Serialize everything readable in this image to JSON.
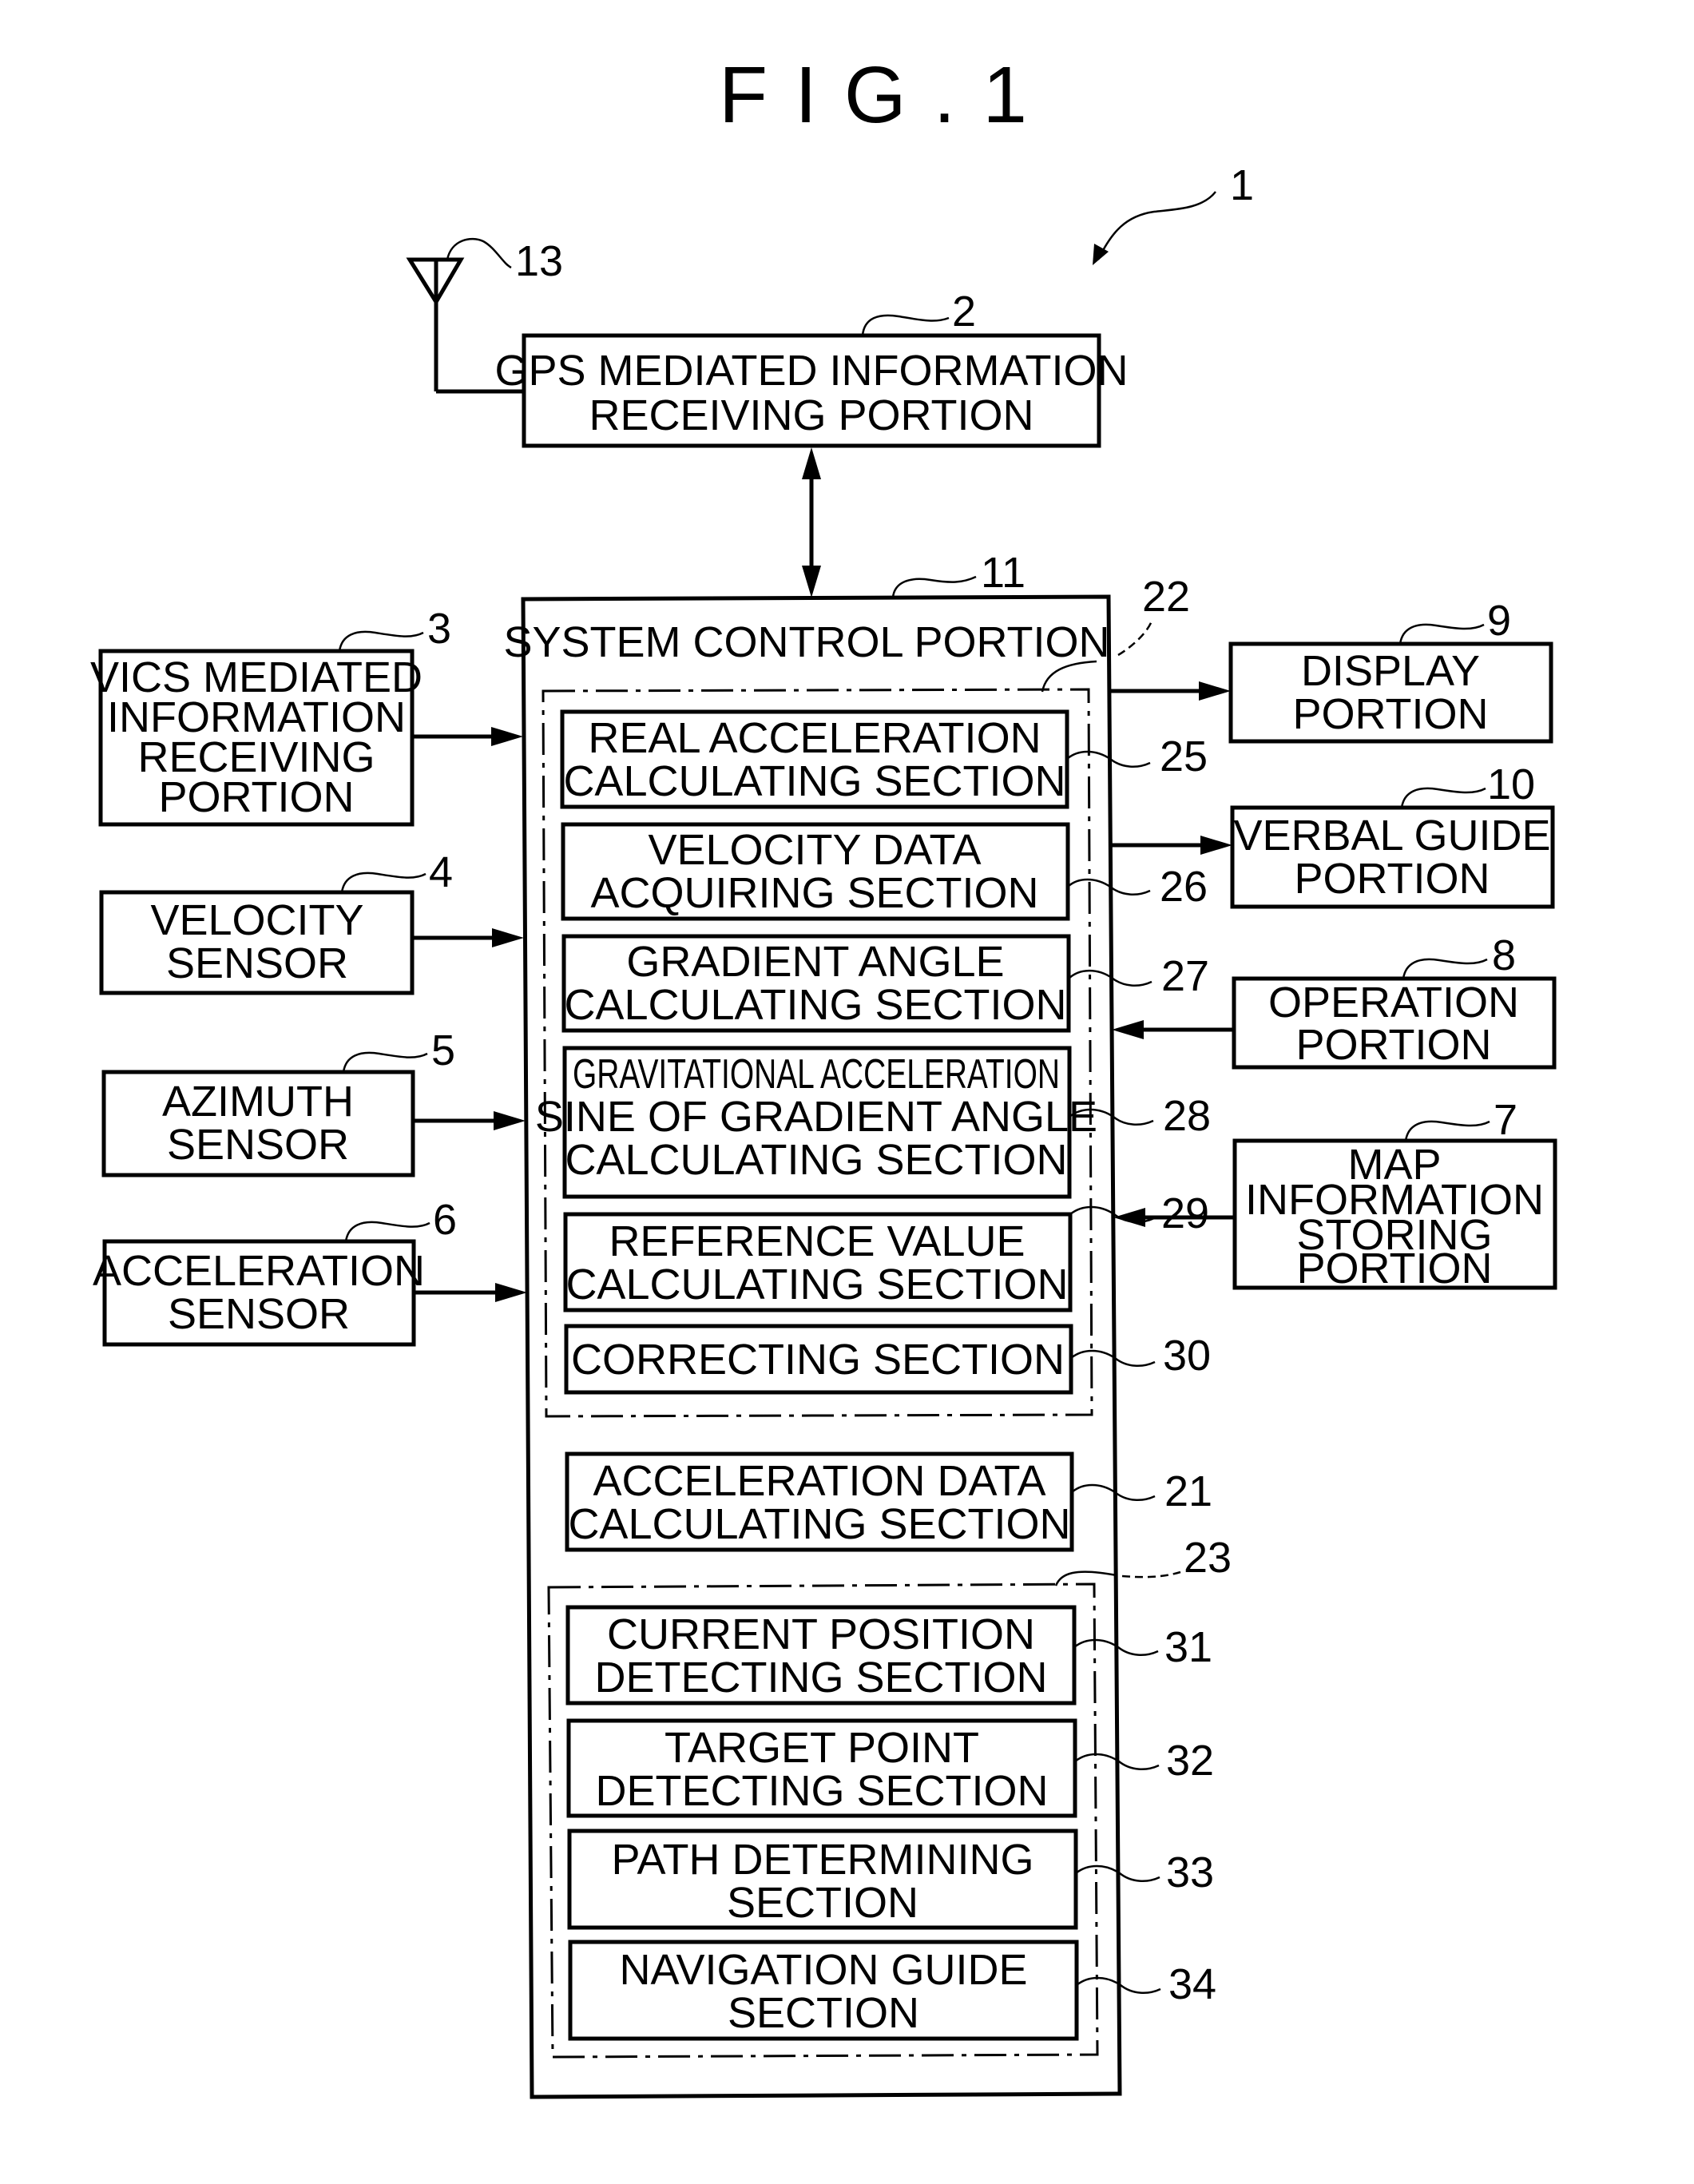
{
  "figure": {
    "title": "FIG.1",
    "system_ref": "1"
  },
  "antenna": {
    "ref": "13",
    "icon": "antenna-icon"
  },
  "blocks": {
    "gps": {
      "ref": "2",
      "lines": [
        "GPS MEDIATED INFORMATION",
        "RECEIVING PORTION"
      ]
    },
    "vics": {
      "ref": "3",
      "lines": [
        "VICS MEDIATED",
        "INFORMATION",
        "RECEIVING",
        "PORTION"
      ]
    },
    "velocity_sensor": {
      "ref": "4",
      "lines": [
        "VELOCITY",
        "SENSOR"
      ]
    },
    "azimuth_sensor": {
      "ref": "5",
      "lines": [
        "AZIMUTH",
        "SENSOR"
      ]
    },
    "acceleration_sensor": {
      "ref": "6",
      "lines": [
        "ACCELERATION",
        "SENSOR"
      ]
    },
    "map_info": {
      "ref": "7",
      "lines": [
        "MAP",
        "INFORMATION",
        "STORING",
        "PORTION"
      ]
    },
    "operation": {
      "ref": "8",
      "lines": [
        "OPERATION",
        "PORTION"
      ]
    },
    "display": {
      "ref": "9",
      "lines": [
        "DISPLAY",
        "PORTION"
      ]
    },
    "verbal_guide": {
      "ref": "10",
      "lines": [
        "VERBAL GUIDE",
        "PORTION"
      ]
    }
  },
  "system_control": {
    "ref": "11",
    "label": "SYSTEM CONTROL PORTION",
    "group_22": {
      "ref": "22",
      "sections": [
        {
          "ref": "25",
          "lines": [
            "REAL ACCELERATION",
            "CALCULATING SECTION"
          ]
        },
        {
          "ref": "26",
          "lines": [
            "VELOCITY DATA",
            "ACQUIRING SECTION"
          ]
        },
        {
          "ref": "27",
          "lines": [
            "GRADIENT ANGLE",
            "CALCULATING SECTION"
          ]
        },
        {
          "ref": "28",
          "lines": [
            "GRAVITATIONAL ACCELERATION",
            "SINE OF GRADIENT ANGLE",
            "CALCULATING SECTION"
          ]
        },
        {
          "ref": "29",
          "lines": [
            "REFERENCE VALUE",
            "CALCULATING SECTION"
          ]
        },
        {
          "ref": "30",
          "lines": [
            "CORRECTING SECTION"
          ]
        }
      ]
    },
    "section_21": {
      "ref": "21",
      "lines": [
        "ACCELERATION DATA",
        "CALCULATING SECTION"
      ]
    },
    "group_23": {
      "ref": "23",
      "sections": [
        {
          "ref": "31",
          "lines": [
            "CURRENT POSITION",
            "DETECTING SECTION"
          ]
        },
        {
          "ref": "32",
          "lines": [
            "TARGET POINT",
            "DETECTING SECTION"
          ]
        },
        {
          "ref": "33",
          "lines": [
            "PATH DETERMINING",
            "SECTION"
          ]
        },
        {
          "ref": "34",
          "lines": [
            "NAVIGATION GUIDE",
            "SECTION"
          ]
        }
      ]
    }
  },
  "connections": [
    {
      "from": "gps",
      "to": "system_control",
      "direction": "bidirectional"
    },
    {
      "from": "vics",
      "to": "system_control",
      "direction": "forward"
    },
    {
      "from": "velocity_sensor",
      "to": "system_control",
      "direction": "forward"
    },
    {
      "from": "azimuth_sensor",
      "to": "system_control",
      "direction": "forward"
    },
    {
      "from": "acceleration_sensor",
      "to": "system_control",
      "direction": "forward"
    },
    {
      "from": "system_control",
      "to": "display",
      "direction": "forward"
    },
    {
      "from": "system_control",
      "to": "verbal_guide",
      "direction": "forward"
    },
    {
      "from": "operation",
      "to": "system_control",
      "direction": "forward"
    },
    {
      "from": "map_info",
      "to": "system_control",
      "direction": "forward"
    },
    {
      "from": "antenna",
      "to": "gps",
      "direction": "none"
    }
  ]
}
